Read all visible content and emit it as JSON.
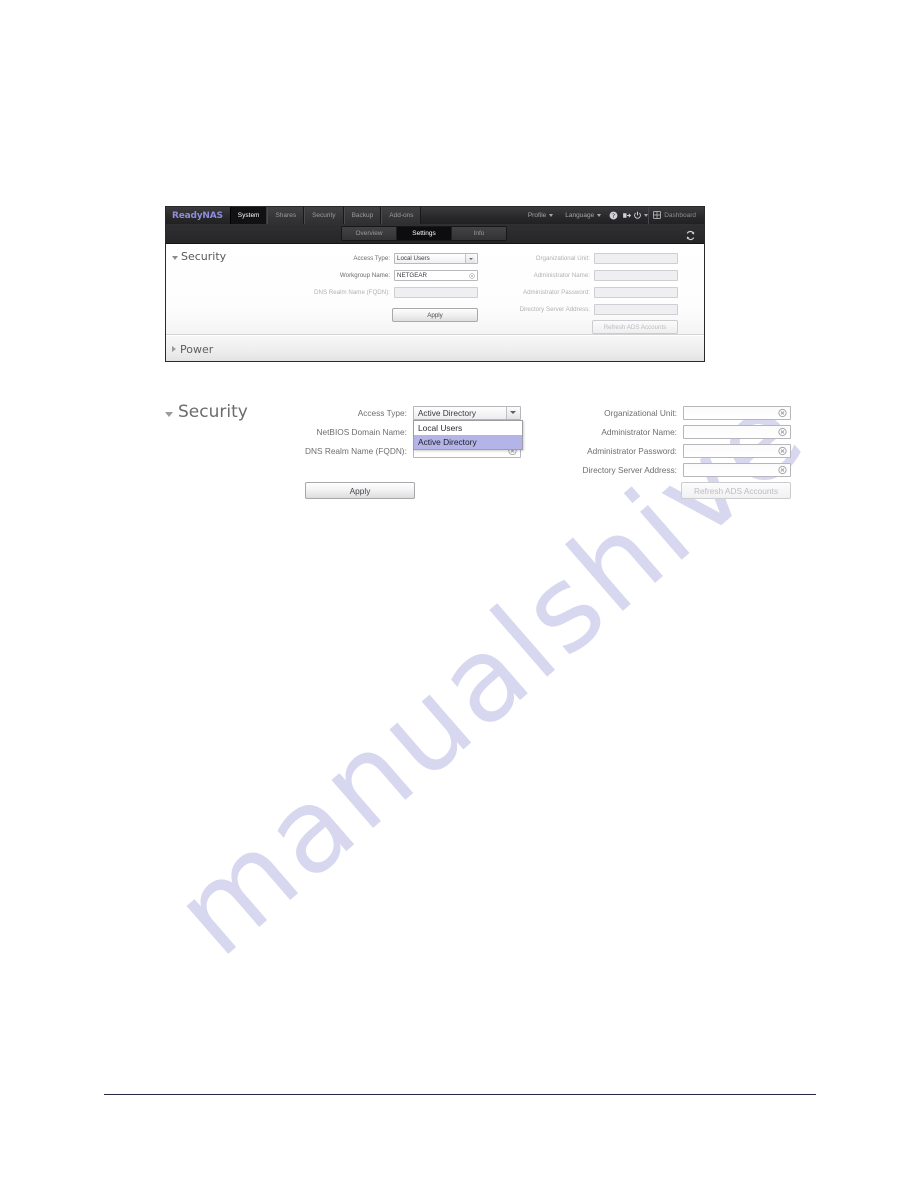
{
  "watermark": {
    "text": "manualshive"
  },
  "app": {
    "brand": "ReadyNAS",
    "main_tabs": [
      {
        "label": "System",
        "active": true
      },
      {
        "label": "Shares",
        "active": false
      },
      {
        "label": "Security",
        "active": false
      },
      {
        "label": "Backup",
        "active": false
      },
      {
        "label": "Add-ons",
        "active": false
      }
    ],
    "menus": [
      {
        "label": "Profile"
      },
      {
        "label": "Language"
      }
    ],
    "icons": {
      "help": "help-icon",
      "logout": "logout-icon",
      "power": "power-icon",
      "dashboard": "dashboard-grid-icon",
      "refresh": "refresh-icon"
    },
    "dashboard_label": "Dashboard",
    "sub_tabs": [
      {
        "label": "Overview",
        "active": false
      },
      {
        "label": "Settings",
        "active": true
      },
      {
        "label": "Info",
        "active": false
      }
    ]
  },
  "figure_small": {
    "security": {
      "heading": "Security",
      "expanded": true,
      "left_fields": [
        {
          "label": "Access Type:",
          "value": "Local Users",
          "type": "select",
          "disabled": false
        },
        {
          "label": "Workgroup Name:",
          "value": "NETGEAR",
          "type": "text",
          "disabled": false,
          "clearable": true
        },
        {
          "label": "DNS Realm Name (FQDN):",
          "value": "",
          "type": "text",
          "disabled": true,
          "clearable": false
        }
      ],
      "right_fields": [
        {
          "label": "Organizational Unit:",
          "value": "",
          "disabled": true
        },
        {
          "label": "Administrator Name:",
          "value": "",
          "disabled": true
        },
        {
          "label": "Administrator Password:",
          "value": "",
          "disabled": true
        },
        {
          "label": "Directory Server Address:",
          "value": "",
          "disabled": true
        }
      ],
      "apply_label": "Apply",
      "refresh_ads_label": "Refresh ADS Accounts"
    },
    "power": {
      "heading": "Power",
      "expanded": false
    }
  },
  "figure_detail": {
    "heading": "Security",
    "left_fields": [
      {
        "label": "Access Type:",
        "value": "Active Directory",
        "type": "select"
      },
      {
        "label": "NetBIOS Domain Name:",
        "value": "",
        "type": "text"
      },
      {
        "label": "DNS Realm Name (FQDN):",
        "value": "",
        "type": "text"
      }
    ],
    "access_type_options": [
      {
        "label": "Local Users",
        "selected": false
      },
      {
        "label": "Active Directory",
        "selected": true
      }
    ],
    "right_fields": [
      {
        "label": "Organizational Unit:",
        "value": ""
      },
      {
        "label": "Administrator Name:",
        "value": ""
      },
      {
        "label": "Administrator Password:",
        "value": ""
      },
      {
        "label": "Directory Server Address:",
        "value": ""
      }
    ],
    "apply_label": "Apply",
    "refresh_ads_label": "Refresh ADS Accounts"
  },
  "colors": {
    "brand": "#8d8ddb",
    "nav_dark": "#2b2b2d",
    "highlight": "#b4b4e8",
    "watermark": "#d7d7f0",
    "footer_rule": "#2b2545"
  }
}
